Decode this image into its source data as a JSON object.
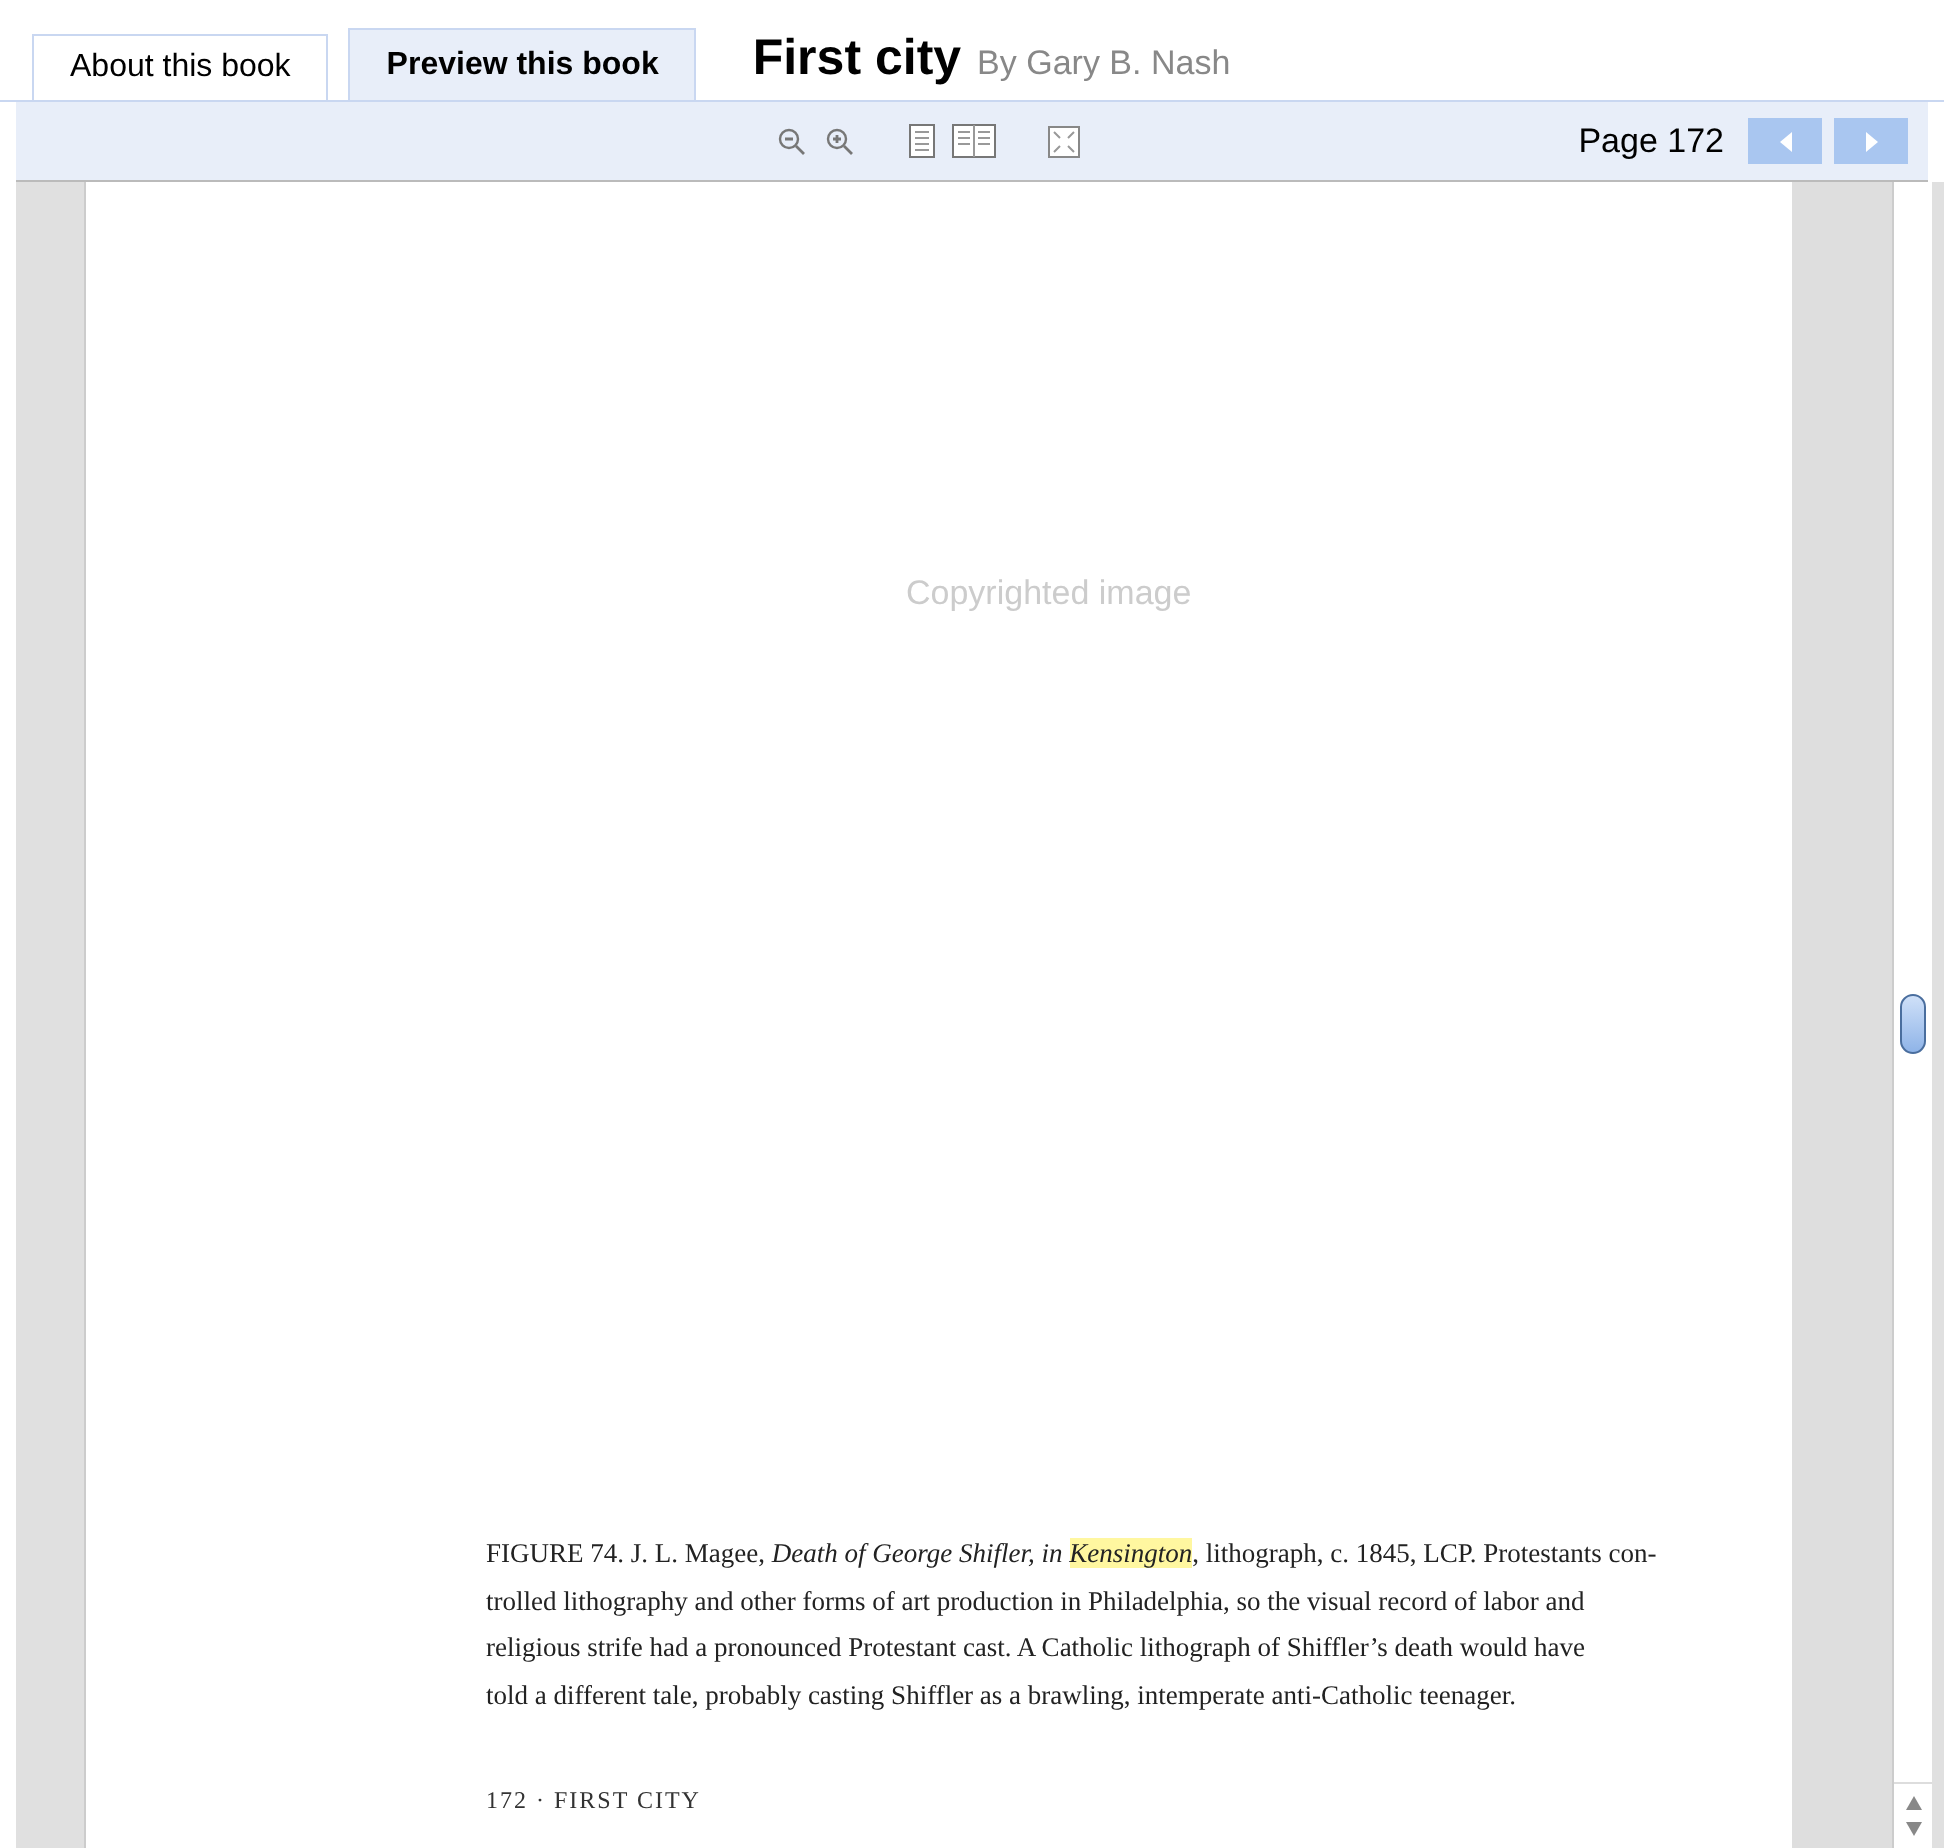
{
  "tabs": [
    {
      "label": "About this book",
      "selected": false
    },
    {
      "label": "Preview this book",
      "selected": true
    }
  ],
  "book": {
    "title": "First city",
    "author": "By Gary B. Nash"
  },
  "toolbar": {
    "page_label": "Page 172"
  },
  "page": {
    "image_note": "Copyrighted image",
    "caption": {
      "first_line": {
        "before": "FIGURE 74. J. L. Magee, *Death of George Shifler, in* ",
        "highlight": "*Kensington*",
        "after": ", lithograph, c. 1845, LCP. Protestants con-"
      },
      "lines": [
        "trolled lithography and other forms of art production in Philadelphia, so the visual record of labor and",
        "religious strife had a pronounced Protestant cast. A Catholic lithograph of Shiffler’s death would have",
        "told a different tale, probably casting Shiffler as a brawling, intemperate anti-Catholic teenager."
      ]
    },
    "footer": "172 · FIRST CITY"
  }
}
